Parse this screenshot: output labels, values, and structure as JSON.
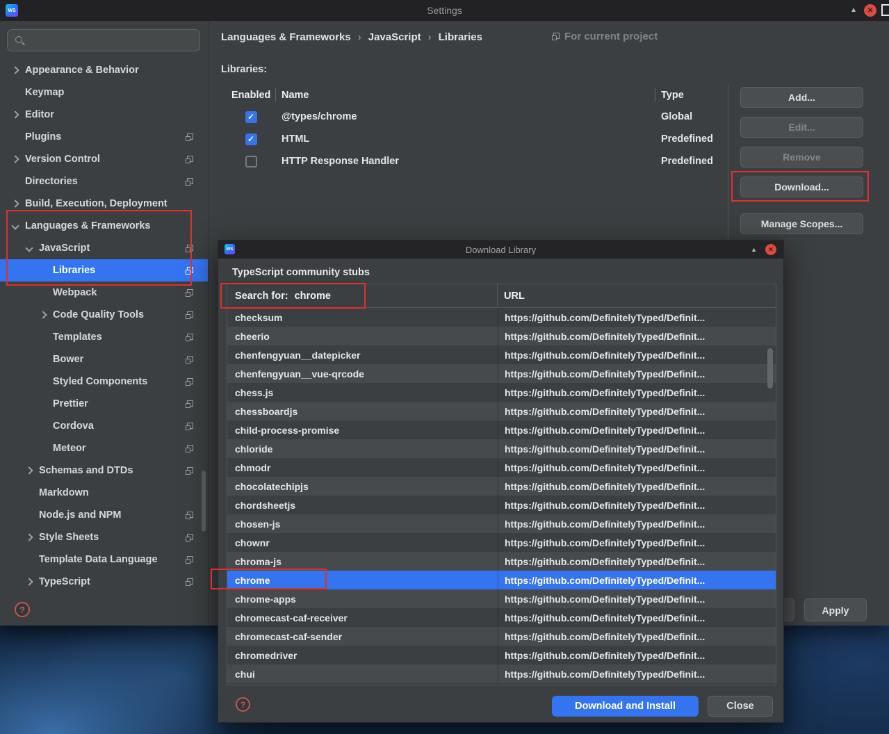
{
  "window": {
    "title": "Settings",
    "minimize_glyph": "▲",
    "close_glyph": "✕"
  },
  "sidebar": {
    "search": {
      "placeholder": ""
    },
    "help_glyph": "?",
    "items": [
      {
        "label": "Appearance & Behavior",
        "indent": 0,
        "chevron": "right",
        "badge": false,
        "selected": false
      },
      {
        "label": "Keymap",
        "indent": 0,
        "chevron": null,
        "badge": false,
        "selected": false
      },
      {
        "label": "Editor",
        "indent": 0,
        "chevron": "right",
        "badge": false,
        "selected": false
      },
      {
        "label": "Plugins",
        "indent": 0,
        "chevron": null,
        "badge": true,
        "selected": false
      },
      {
        "label": "Version Control",
        "indent": 0,
        "chevron": "right",
        "badge": true,
        "selected": false
      },
      {
        "label": "Directories",
        "indent": 0,
        "chevron": null,
        "badge": true,
        "selected": false
      },
      {
        "label": "Build, Execution, Deployment",
        "indent": 0,
        "chevron": "right",
        "badge": false,
        "selected": false
      },
      {
        "label": "Languages & Frameworks",
        "indent": 0,
        "chevron": "down",
        "badge": false,
        "selected": false
      },
      {
        "label": "JavaScript",
        "indent": 1,
        "chevron": "down",
        "badge": true,
        "selected": false
      },
      {
        "label": "Libraries",
        "indent": 2,
        "chevron": null,
        "badge": true,
        "selected": true
      },
      {
        "label": "Webpack",
        "indent": 2,
        "chevron": null,
        "badge": true,
        "selected": false
      },
      {
        "label": "Code Quality Tools",
        "indent": 2,
        "chevron": "right",
        "badge": true,
        "selected": false
      },
      {
        "label": "Templates",
        "indent": 2,
        "chevron": null,
        "badge": true,
        "selected": false
      },
      {
        "label": "Bower",
        "indent": 2,
        "chevron": null,
        "badge": true,
        "selected": false
      },
      {
        "label": "Styled Components",
        "indent": 2,
        "chevron": null,
        "badge": true,
        "selected": false
      },
      {
        "label": "Prettier",
        "indent": 2,
        "chevron": null,
        "badge": true,
        "selected": false
      },
      {
        "label": "Cordova",
        "indent": 2,
        "chevron": null,
        "badge": true,
        "selected": false
      },
      {
        "label": "Meteor",
        "indent": 2,
        "chevron": null,
        "badge": true,
        "selected": false
      },
      {
        "label": "Schemas and DTDs",
        "indent": 1,
        "chevron": "right",
        "badge": true,
        "selected": false
      },
      {
        "label": "Markdown",
        "indent": 1,
        "chevron": null,
        "badge": false,
        "selected": false
      },
      {
        "label": "Node.js and NPM",
        "indent": 1,
        "chevron": null,
        "badge": true,
        "selected": false
      },
      {
        "label": "Style Sheets",
        "indent": 1,
        "chevron": "right",
        "badge": true,
        "selected": false
      },
      {
        "label": "Template Data Language",
        "indent": 1,
        "chevron": null,
        "badge": true,
        "selected": false
      },
      {
        "label": "TypeScript",
        "indent": 1,
        "chevron": "right",
        "badge": true,
        "selected": false
      }
    ]
  },
  "main": {
    "breadcrumb": {
      "items": [
        "Languages & Frameworks",
        "JavaScript",
        "Libraries"
      ],
      "separator": "›",
      "scope_label": "For current project"
    },
    "section_label": "Libraries:",
    "table": {
      "columns": [
        "Enabled",
        "Name",
        "Type"
      ],
      "check_glyph": "✓",
      "rows": [
        {
          "enabled": true,
          "name": "@types/chrome",
          "type": "Global"
        },
        {
          "enabled": true,
          "name": "HTML",
          "type": "Predefined"
        },
        {
          "enabled": false,
          "name": "HTTP Response Handler",
          "type": "Predefined"
        }
      ]
    },
    "actions": [
      {
        "label": "Add...",
        "disabled": false,
        "highlighted": false
      },
      {
        "label": "Edit...",
        "disabled": true,
        "highlighted": false
      },
      {
        "label": "Remove",
        "disabled": true,
        "highlighted": false
      },
      {
        "label": "Download...",
        "disabled": false,
        "highlighted": true
      },
      {
        "label": "Manage Scopes...",
        "disabled": false,
        "highlighted": false
      }
    ],
    "apply_button": "Apply"
  },
  "modal": {
    "title": "Download Library",
    "minimize_glyph": "▲",
    "close_glyph": "✕",
    "heading": "TypeScript community stubs",
    "search_label": "Search for:",
    "search_value": "chrome",
    "url_column": "URL",
    "url_text": "https://github.com/DefinitelyTyped/Definit...",
    "selected_stub": "chrome",
    "stubs": [
      "checksum",
      "cheerio",
      "chenfengyuan__datepicker",
      "chenfengyuan__vue-qrcode",
      "chess.js",
      "chessboardjs",
      "child-process-promise",
      "chloride",
      "chmodr",
      "chocolatechipjs",
      "chordsheetjs",
      "chosen-js",
      "chownr",
      "chroma-js",
      "chrome",
      "chrome-apps",
      "chromecast-caf-receiver",
      "chromecast-caf-sender",
      "chromedriver",
      "chui"
    ],
    "download_button": "Download and Install",
    "close_button": "Close",
    "help_glyph": "?"
  },
  "colors": {
    "selection_blue": "#3574f0",
    "annotation_red": "#e0302c",
    "panel_bg": "#3c3f41"
  }
}
